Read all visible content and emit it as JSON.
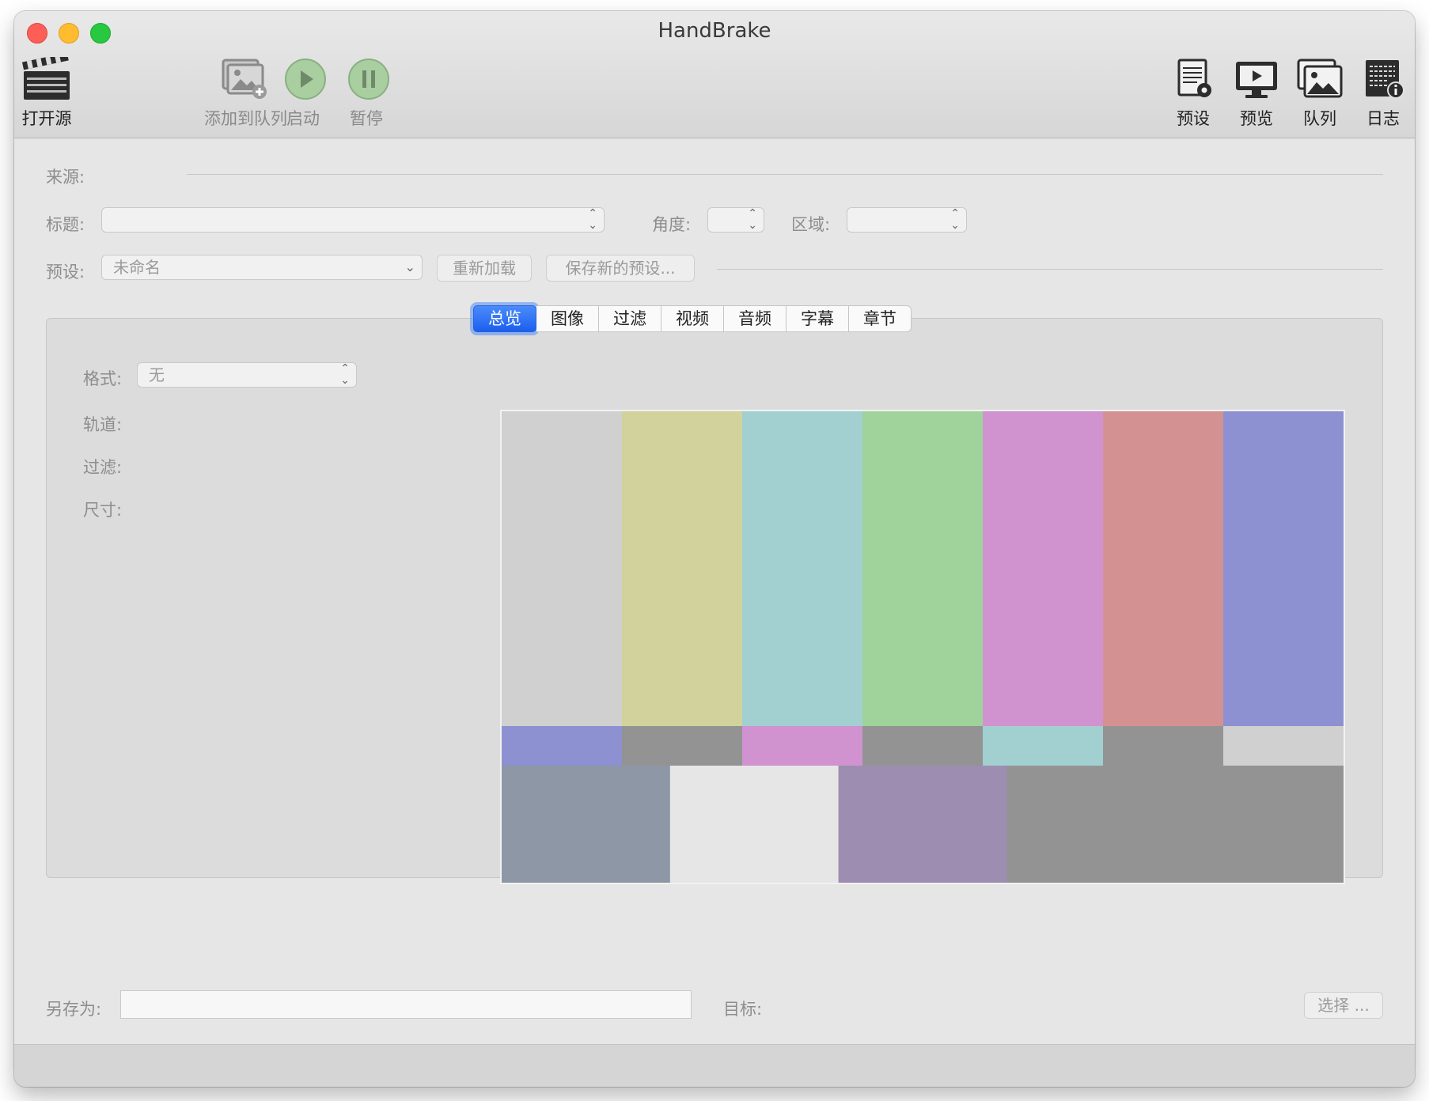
{
  "window": {
    "title": "HandBrake"
  },
  "toolbar": {
    "open_source": "打开源",
    "add_to_queue": "添加到队列",
    "start": "启动",
    "pause": "暂停",
    "presets": "预设",
    "preview": "预览",
    "queue": "队列",
    "log": "日志"
  },
  "source": {
    "label": "来源:"
  },
  "title_row": {
    "title_label": "标题:",
    "angle_label": "角度:",
    "region_label": "区域:"
  },
  "preset_row": {
    "label": "预设:",
    "value": "未命名",
    "reload_button": "重新加载",
    "save_new_button": "保存新的预设..."
  },
  "tabs": [
    {
      "label": "总览",
      "active": true
    },
    {
      "label": "图像",
      "active": false
    },
    {
      "label": "过滤",
      "active": false
    },
    {
      "label": "视频",
      "active": false
    },
    {
      "label": "音频",
      "active": false
    },
    {
      "label": "字幕",
      "active": false
    },
    {
      "label": "章节",
      "active": false
    }
  ],
  "summary": {
    "format_label": "格式:",
    "format_value": "无",
    "tracks_label": "轨道:",
    "filters_label": "过滤:",
    "size_label": "尺寸:"
  },
  "color_bars": {
    "top": [
      "#d0d0d0",
      "#d2d29c",
      "#a2cfcf",
      "#a0d39c",
      "#d192d0",
      "#d49191",
      "#8d91d1"
    ],
    "middle": [
      "#8d91d1",
      "#939393",
      "#d192d0",
      "#939393",
      "#a2cfcf",
      "#939393",
      "#d0d0d0"
    ],
    "bottom": [
      "#8d97a6",
      "#e6e6e6",
      "#9d8db0",
      "#939393",
      "#939393"
    ]
  },
  "bottom": {
    "save_as_label": "另存为:",
    "save_as_value": "",
    "target_label": "目标:",
    "choose_button": "选择 ..."
  }
}
